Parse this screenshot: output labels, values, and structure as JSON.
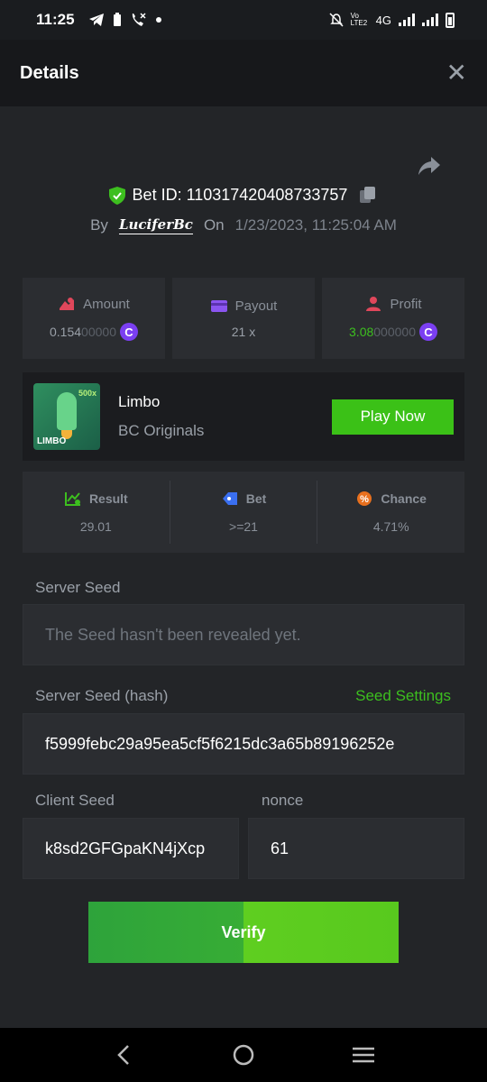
{
  "status_bar": {
    "time": "11:25",
    "network": "4G",
    "volte": "Vo LTE2"
  },
  "header": {
    "title": "Details"
  },
  "bet": {
    "id_label": "Bet ID: 110317420408733757",
    "by_label": "By",
    "username": "LuciferBc",
    "on_label": "On",
    "date": "1/23/2023, 11:25:04 AM"
  },
  "stats": {
    "amount_label": "Amount",
    "amount_main": "0.154",
    "amount_dim": "00000",
    "payout_label": "Payout",
    "payout_value": "21 x",
    "profit_label": "Profit",
    "profit_main": "3.08",
    "profit_dim": "000000",
    "coin_symbol": "C"
  },
  "game": {
    "name": "Limbo",
    "provider": "BC Originals",
    "play_label": "Play Now",
    "thumb_tag": "LIMBO",
    "thumb_mult": "500x"
  },
  "results": {
    "result_label": "Result",
    "result_value": "29.01",
    "bet_label": "Bet",
    "bet_value": ">=21",
    "chance_label": "Chance",
    "chance_value": "4.71%"
  },
  "server_seed": {
    "label": "Server Seed",
    "value": "The Seed hasn't been revealed yet."
  },
  "server_seed_hash": {
    "label": "Server Seed (hash)",
    "settings_label": "Seed Settings",
    "value": "f5999febc29a95ea5cf5f6215dc3a65b89196252e"
  },
  "client_seed": {
    "label": "Client Seed",
    "value": "k8sd2GFGpaKN4jXcp"
  },
  "nonce": {
    "label": "nonce",
    "value": "61"
  },
  "verify_label": "Verify",
  "colors": {
    "accent_green": "#3bc117",
    "coin_purple": "#7b3ff2",
    "amount_icon": "#e0475b",
    "payout_icon": "#8b55f0",
    "profit_icon": "#e0475b"
  }
}
